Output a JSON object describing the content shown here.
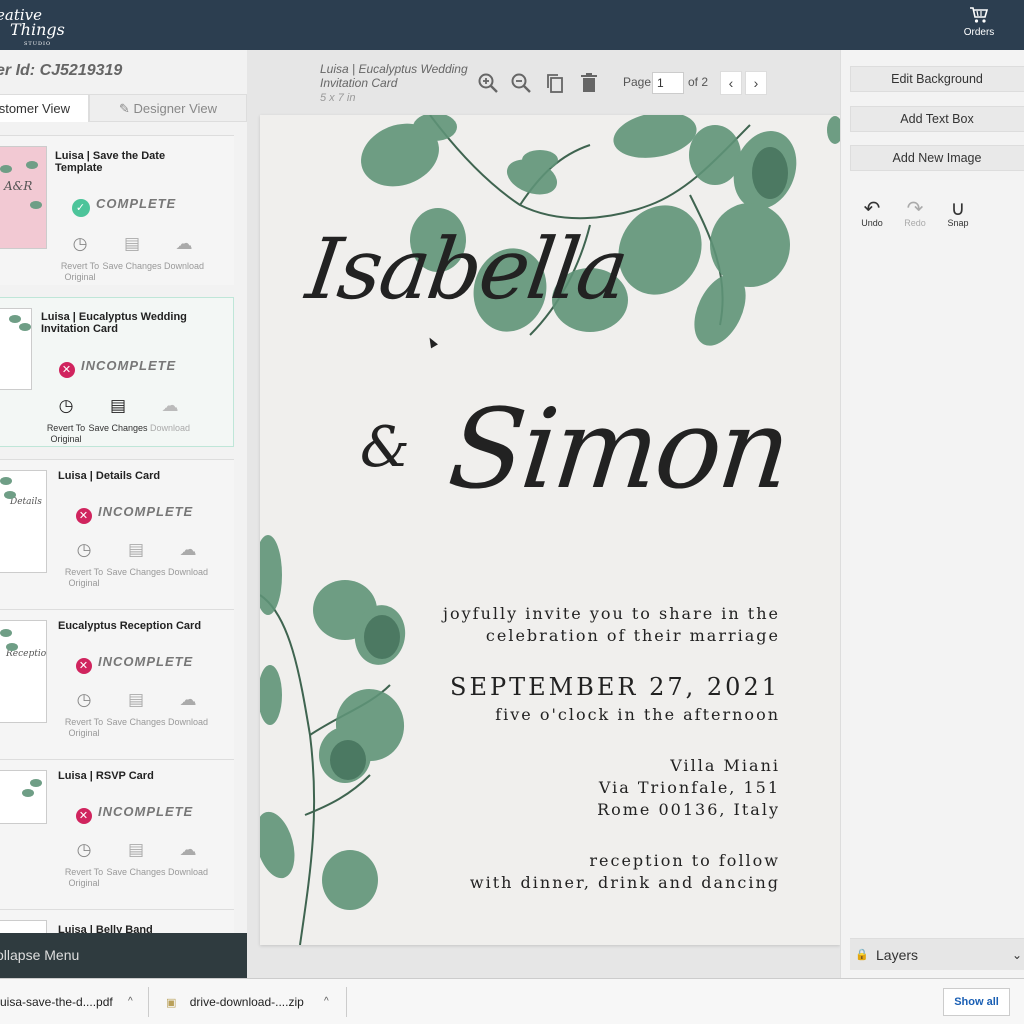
{
  "topbar": {
    "logo_line1": "eative",
    "logo_line2": "Things",
    "logo_line3": "STUDIO",
    "orders_label": "Orders",
    "orders_icon": "cart-icon"
  },
  "sidebar": {
    "order_id": "er Id: CJ5219319",
    "tab_customer": "stomer View",
    "tab_designer": "Designer View",
    "cards": [
      {
        "title": "Luisa | Save the Date Template",
        "status": "COMPLETE",
        "actions": [
          "Revert To Original",
          "Save Changes",
          "Download"
        ]
      },
      {
        "title": "Luisa | Eucalyptus Wedding Invitation Card",
        "status": "INCOMPLETE",
        "actions": [
          "Revert To Original",
          "Save Changes",
          "Download"
        ]
      },
      {
        "title": "Luisa | Details Card",
        "status": "INCOMPLETE",
        "actions": [
          "Revert To Original",
          "Save Changes",
          "Download"
        ]
      },
      {
        "title": "Eucalyptus Reception Card",
        "status": "INCOMPLETE",
        "actions": [
          "Revert To Original",
          "Save Changes",
          "Download"
        ]
      },
      {
        "title": "Luisa | RSVP Card",
        "status": "INCOMPLETE",
        "actions": [
          "Revert To Original",
          "Save Changes",
          "Download"
        ]
      },
      {
        "title": "Luisa | Belly Band",
        "status": "",
        "actions": []
      }
    ],
    "thumb_texts": {
      "save_date": "A&R",
      "details": "Details",
      "reception": "Reception"
    },
    "collapse_label": "ollapse Menu"
  },
  "editor": {
    "doc_title": "Luisa | Eucalyptus Wedding Invitation Card",
    "doc_size": "5 x 7 in",
    "page_label": "Page",
    "page_value": "1",
    "page_of": "of 2",
    "prev_icon": "chevron-left-icon",
    "next_icon": "chevron-right-icon"
  },
  "invitation": {
    "name1": "Isabella",
    "amp": "&",
    "name2": "Simon",
    "invite_line1": "joyfully invite you to share in the",
    "invite_line2": "celebration of their marriage",
    "date": "SEPTEMBER 27, 2021",
    "time": "five o'clock in the afternoon",
    "venue_line1": "Villa Miani",
    "venue_line2": "Via Trionfale, 151",
    "venue_line3": "Rome  00136, Italy",
    "reception_line1": "reception to follow",
    "reception_line2": "with dinner, drink and dancing"
  },
  "right_panel": {
    "edit_background": "Edit Background",
    "add_text_box": "Add Text Box",
    "add_new_image": "Add New Image",
    "undo": "Undo",
    "redo": "Redo",
    "snap": "Snap",
    "layers": "Layers"
  },
  "downloads": {
    "file1": "uisa-save-the-d....pdf",
    "file2": "drive-download-....zip",
    "show_all": "Show all"
  },
  "colors": {
    "topbar": "#2c3e50",
    "complete": "#4cc49a",
    "incomplete": "#d0245e",
    "leaf": "#5f9478"
  }
}
